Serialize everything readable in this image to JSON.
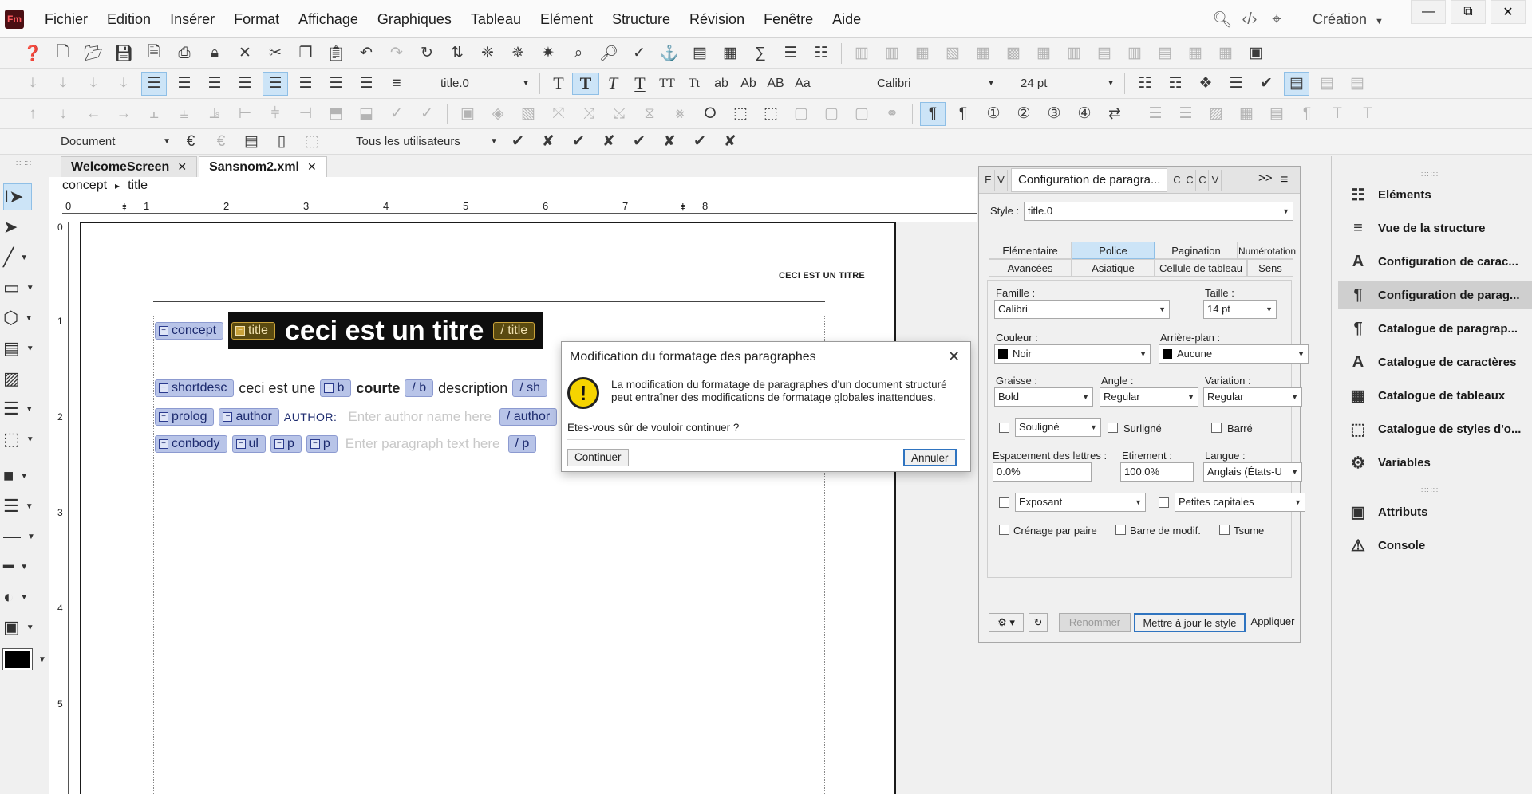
{
  "app": {
    "logo": "Fm"
  },
  "menu": [
    "Fichier",
    "Edition",
    "Insérer",
    "Format",
    "Affichage",
    "Graphiques",
    "Tableau",
    "Elément",
    "Structure",
    "Révision",
    "Fenêtre",
    "Aide"
  ],
  "workspace": {
    "label": "Création"
  },
  "toolbar": {
    "para_style": "title.0",
    "font_family": "Calibri",
    "font_size": "24 pt",
    "tracking_doc": "Document",
    "tracking_users": "Tous les utilisateurs",
    "text_styles": [
      "T",
      "T",
      "T",
      "T",
      "TT",
      "Tt",
      "ab",
      "Ab",
      "AB",
      "Aa"
    ]
  },
  "tabs": [
    {
      "label": "WelcomeScreen"
    },
    {
      "label": "Sansnom2.xml"
    }
  ],
  "breadcrumb": {
    "root": "concept",
    "sep": "▸",
    "leaf": "title"
  },
  "ruler": {
    "h": [
      "0",
      "1",
      "2",
      "3",
      "4",
      "5",
      "6",
      "7",
      "8"
    ],
    "v": [
      "0",
      "1",
      "2",
      "3",
      "4",
      "5"
    ]
  },
  "document": {
    "running_head": "CECI EST UN TITRE",
    "tag_concept": "concept",
    "tag_title": "title",
    "tag_title_end": "/ title",
    "title_text": "ceci est un titre",
    "tag_shortdesc": "shortdesc",
    "shortdesc_text1": "ceci est une",
    "tag_b": "b",
    "bold_text": "courte",
    "tag_b_end": "/ b",
    "shortdesc_text2": "description",
    "tag_shortdesc_end": "/ sh",
    "tag_prolog": "prolog",
    "tag_author": "author",
    "author_label": "AUTHOR:",
    "author_placeholder": "Enter author name here",
    "tag_author_end": "/ author",
    "tag_conbody": "conbody",
    "tag_ul": "ul",
    "tag_p1": "p",
    "tag_p2": "p",
    "p_placeholder": "Enter paragraph text here",
    "tag_p_end": "/ p"
  },
  "dialog": {
    "title": "Modification du formatage des paragraphes",
    "close": "✕",
    "message": "La modification du formatage de paragraphes d'un document structuré peut entraîner des modifications de formatage globales inattendues.",
    "question": "Etes-vous sûr de vouloir continuer ?",
    "continue": "Continuer",
    "cancel": "Annuler"
  },
  "para_designer": {
    "mini_tabs_left": [
      "E",
      "V"
    ],
    "active_tab": "Configuration de paragra...",
    "mini_tabs_right": [
      "C",
      "C",
      "C",
      "V"
    ],
    "more": ">>",
    "style_label": "Style :",
    "style_value": "title.0",
    "prop_tabs_row1": [
      "Elémentaire",
      "Police",
      "Pagination",
      "Numérotation"
    ],
    "prop_tabs_row2": [
      "Avancées",
      "Asiatique",
      "Cellule de tableau",
      "Sens"
    ],
    "famille_label": "Famille :",
    "famille_value": "Calibri",
    "taille_label": "Taille :",
    "taille_value": "14 pt",
    "couleur_label": "Couleur :",
    "couleur_value": "Noir",
    "arriere_label": "Arrière-plan :",
    "arriere_value": "Aucune",
    "graisse_label": "Graisse :",
    "graisse_value": "Bold",
    "angle_label": "Angle :",
    "angle_value": "Regular",
    "variation_label": "Variation :",
    "variation_value": "Regular",
    "souligne_value": "Souligné",
    "surligne_label": "Surligné",
    "barre_label": "Barré",
    "espacement_label": "Espacement des lettres :",
    "espacement_value": "0.0%",
    "etirement_label": "Etirement :",
    "etirement_value": "100.0%",
    "langue_label": "Langue :",
    "langue_value": "Anglais (États-U",
    "exposant_value": "Exposant",
    "petites_value": "Petites capitales",
    "crenage_label": "Crénage par paire",
    "barre_modif_label": "Barre de modif.",
    "tsume_label": "Tsume",
    "btn_rename": "Renommer",
    "btn_update": "Mettre à jour le style",
    "btn_apply": "Appliquer"
  },
  "right_panel": [
    {
      "label": "Eléments",
      "icon": "elements-icon"
    },
    {
      "label": "Vue de la structure",
      "icon": "structure-view-icon"
    },
    {
      "label": "Configuration de carac...",
      "icon": "char-designer-icon"
    },
    {
      "label": "Configuration de parag...",
      "icon": "para-designer-icon"
    },
    {
      "label": "Catalogue de paragrap...",
      "icon": "para-catalog-icon"
    },
    {
      "label": "Catalogue de caractères",
      "icon": "char-catalog-icon"
    },
    {
      "label": "Catalogue de tableaux",
      "icon": "table-catalog-icon"
    },
    {
      "label": "Catalogue de styles d'o...",
      "icon": "object-styles-icon"
    },
    {
      "label": "Variables",
      "icon": "variables-icon"
    },
    {
      "label": "Attributs",
      "icon": "attributes-icon"
    },
    {
      "label": "Console",
      "icon": "console-icon"
    }
  ],
  "colors": {
    "accent": "#2f74c0",
    "selection": "#cce4f7",
    "tag": "#b8c4e8",
    "warning": "#f6d400"
  }
}
